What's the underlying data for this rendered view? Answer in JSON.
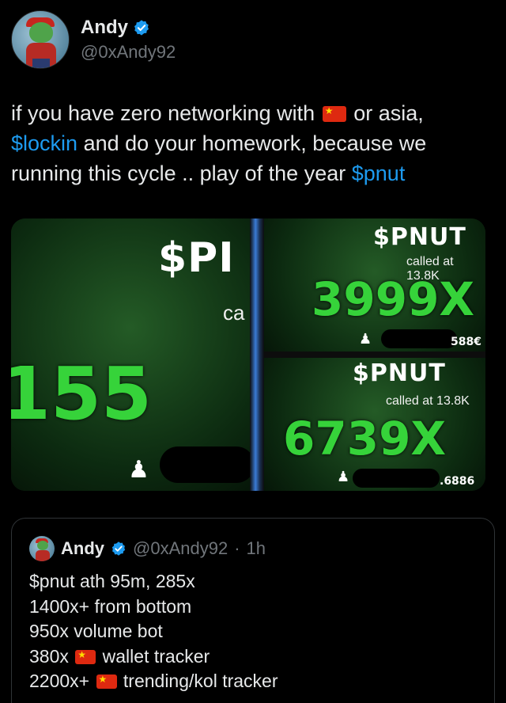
{
  "author": {
    "display_name": "Andy",
    "handle": "@0xAndy92",
    "verified_icon": "verified-badge-icon",
    "avatar_icon": "pepe-avatar-icon"
  },
  "tweet": {
    "seg1": "if you have zero networking with",
    "flag": "china-flag-icon",
    "seg2": "or asia,",
    "cashtag1": "$lockin",
    "seg3": "and do your homework, because we running this cycle .. play of the year",
    "cashtag2": "$pnut"
  },
  "media": {
    "left": {
      "ticker": "$PI",
      "called": "ca",
      "multiplier": "155"
    },
    "top_right": {
      "ticker": "$PNUT",
      "called": "called at 13.8K",
      "multiplier": "3999X",
      "tail": "588€"
    },
    "bottom_right": {
      "ticker": "$PNUT",
      "called": "called at 13.8K",
      "multiplier": "6739X",
      "tail": ".6886"
    }
  },
  "quote": {
    "display_name": "Andy",
    "handle": "@0xAndy92",
    "dot": "·",
    "time": "1h",
    "lines": [
      {
        "text": "$pnut ath 95m, 285x",
        "flag": false,
        "after": ""
      },
      {
        "text": "1400x+ from bottom",
        "flag": false,
        "after": ""
      },
      {
        "text": "950x volume bot",
        "flag": false,
        "after": ""
      },
      {
        "text": "380x",
        "flag": true,
        "after": "wallet tracker"
      },
      {
        "text": "2200x+",
        "flag": true,
        "after": "trending/kol tracker"
      }
    ]
  },
  "colors": {
    "background": "#000000",
    "text": "#e7e9ea",
    "secondary": "#71767b",
    "link": "#1d9bf0",
    "verified": "#1d9bf0",
    "multiplier_green": "#36d33a"
  }
}
